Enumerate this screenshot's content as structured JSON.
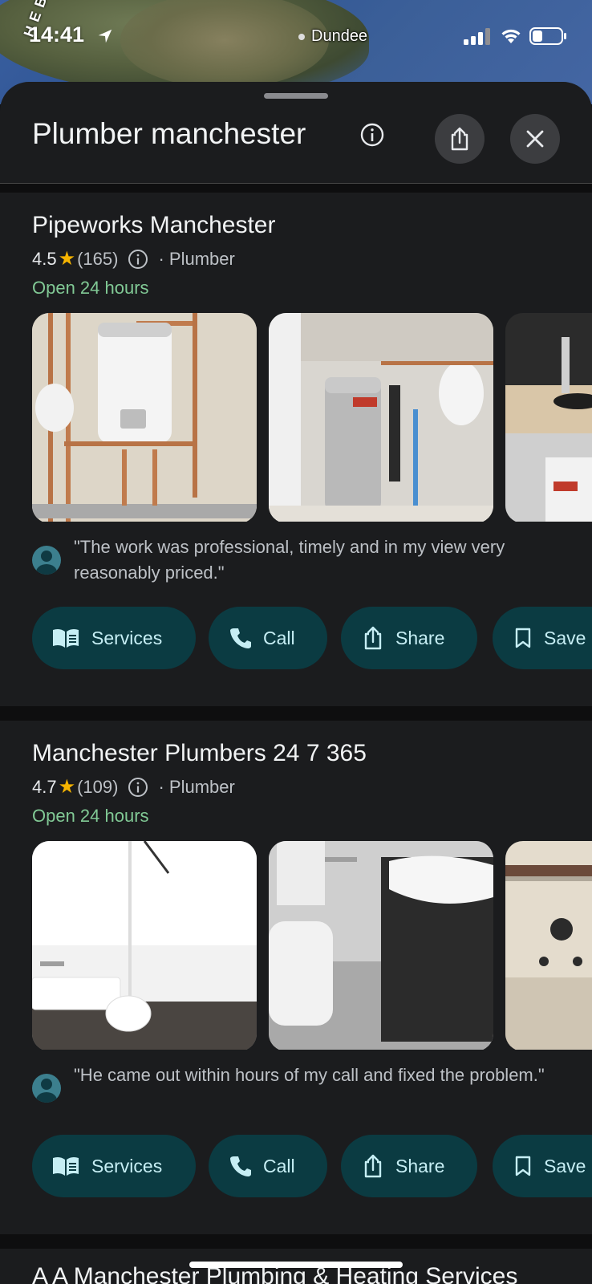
{
  "status_bar": {
    "time": "14:41",
    "map_label": "Dundee",
    "map_edge_label": "H E B"
  },
  "sheet": {
    "title": "Plumber manchester"
  },
  "results": [
    {
      "name": "Pipeworks Manchester",
      "rating": "4.5",
      "reviews": "(165)",
      "category": "· Plumber",
      "hours": "Open 24 hours",
      "review_snippet": "\"The work was professional, timely and in my view very reasonably priced.\"",
      "actions": [
        "Services",
        "Call",
        "Share",
        "Save"
      ]
    },
    {
      "name": "Manchester Plumbers 24 7 365",
      "rating": "4.7",
      "reviews": "(109)",
      "category": "· Plumber",
      "hours": "Open 24 hours",
      "review_snippet": "\"He came out within hours of my call and fixed the problem.\"",
      "actions": [
        "Services",
        "Call",
        "Share",
        "Save"
      ]
    },
    {
      "name": "A A Manchester Plumbing & Heating Services"
    }
  ],
  "colors": {
    "accent_open": "#81c995",
    "chip_bg": "#0b3b42",
    "star": "#f6b400"
  },
  "icons": [
    "location-arrow-icon",
    "signal-icon",
    "wifi-icon",
    "battery-icon",
    "info-icon",
    "share-icon",
    "close-icon",
    "star-icon",
    "services-book-icon",
    "phone-icon",
    "bookmark-icon",
    "avatar-icon"
  ]
}
